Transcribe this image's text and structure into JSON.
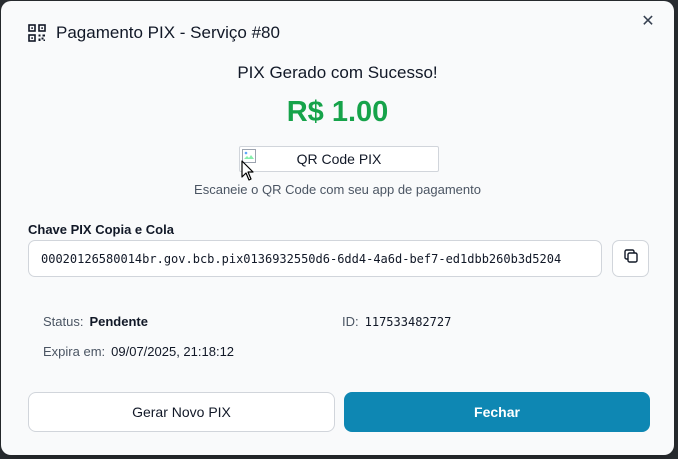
{
  "dialog": {
    "title": "Pagamento PIX - Serviço #80",
    "close_glyph": "✕",
    "icon": "qr-code-icon"
  },
  "content": {
    "success_title": "PIX Gerado com Sucesso!",
    "amount": "R$ 1.00",
    "amount_color": "#16a34a",
    "qr_alt": "QR Code PIX",
    "qr_caption": "Escaneie o QR Code com seu app de pagamento"
  },
  "pix_key": {
    "label": "Chave PIX Copia e Cola",
    "value": "00020126580014br.gov.bcb.pix0136932550d6-6dd4-4a6d-bef7-ed1dbb260b3d5204"
  },
  "info": {
    "status_label": "Status:",
    "status_value": "Pendente",
    "id_label": "ID:",
    "id_value": "117533482727",
    "expires_label": "Expira em:",
    "expires_value": "09/07/2025, 21:18:12"
  },
  "actions": {
    "secondary_label": "Gerar Novo PIX",
    "primary_label": "Fechar",
    "primary_color": "#0e87b3"
  }
}
